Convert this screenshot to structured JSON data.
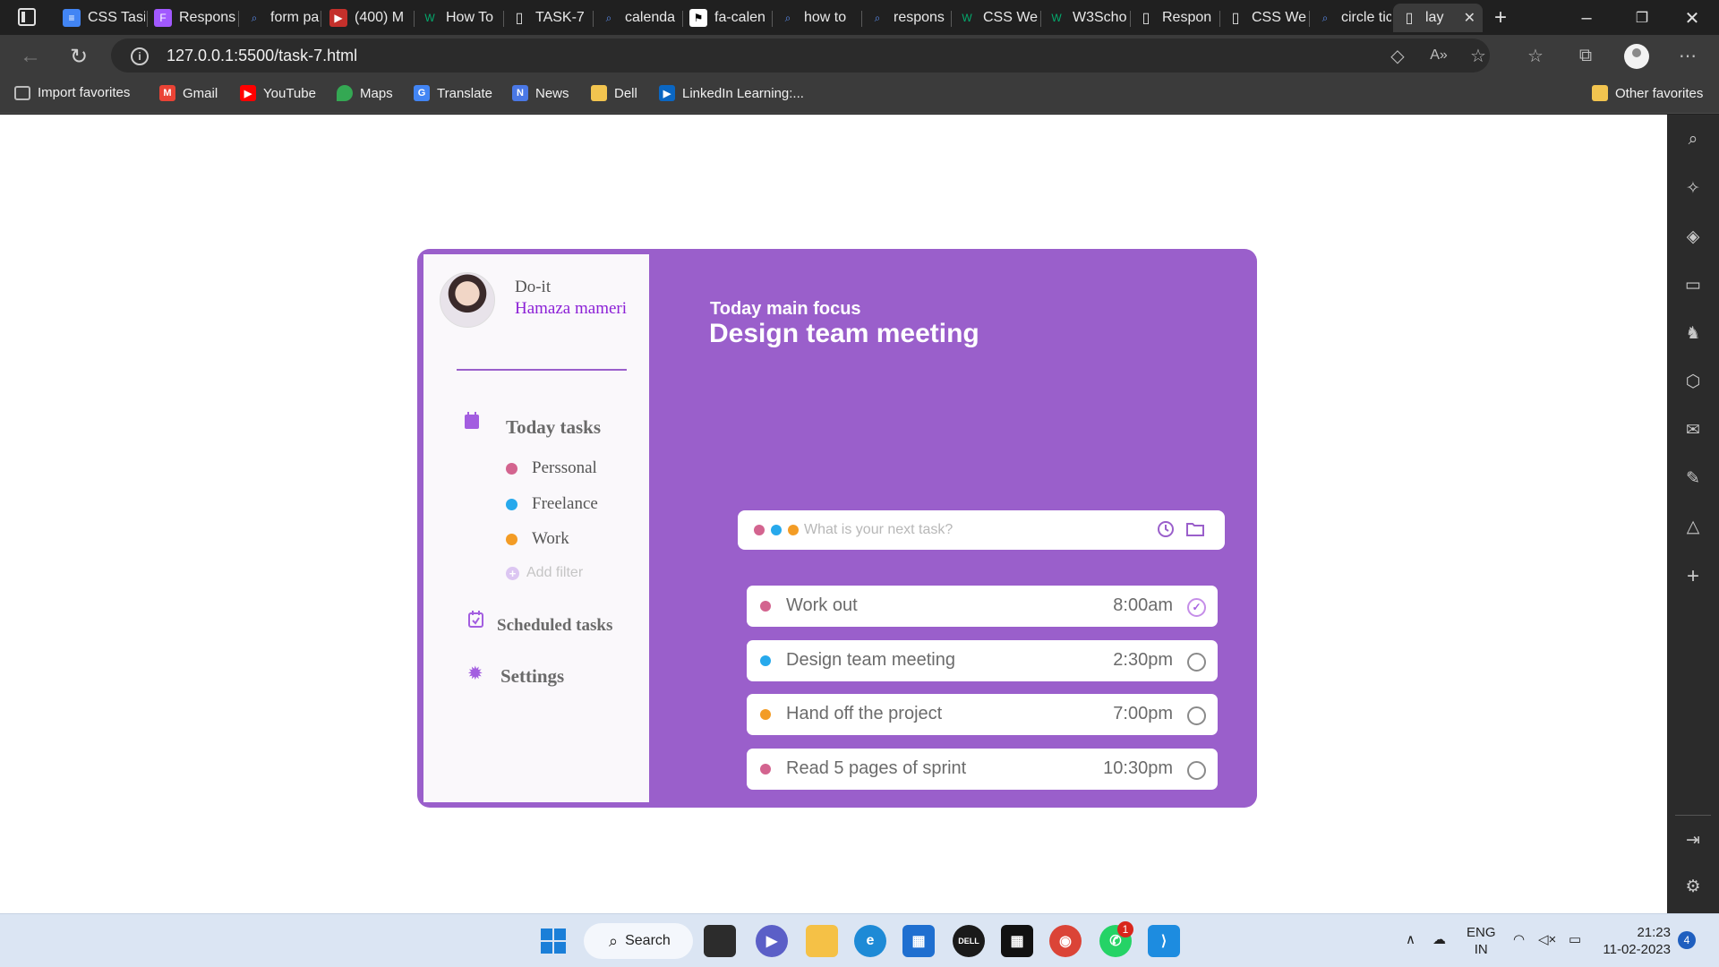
{
  "browser": {
    "tabs": [
      {
        "title": "CSS Tasi",
        "icon": "google-docs-icon",
        "color": "#4285f4"
      },
      {
        "title": "Respons",
        "icon": "figma-icon",
        "color": "#a259ff"
      },
      {
        "title": "form pa",
        "icon": "search-icon",
        "color": "#5b8def"
      },
      {
        "title": "(400) M",
        "icon": "youtube-icon",
        "color": "#ff0000"
      },
      {
        "title": "How To",
        "icon": "w3schools-icon",
        "color": "#04aa6d"
      },
      {
        "title": "TASK-7",
        "icon": "page-icon",
        "color": "#9e9e9e"
      },
      {
        "title": "calenda",
        "icon": "search-icon",
        "color": "#5b8def"
      },
      {
        "title": "fa-calen",
        "icon": "flag-icon",
        "color": "#ffffff"
      },
      {
        "title": "how to",
        "icon": "search-icon",
        "color": "#5b8def"
      },
      {
        "title": "respons",
        "icon": "search-icon",
        "color": "#5b8def"
      },
      {
        "title": "CSS We",
        "icon": "w3schools-icon",
        "color": "#04aa6d"
      },
      {
        "title": "W3Scho",
        "icon": "w3schools-icon",
        "color": "#04aa6d"
      },
      {
        "title": "Respon",
        "icon": "page-icon",
        "color": "#9e9e9e"
      },
      {
        "title": "CSS We",
        "icon": "page-icon",
        "color": "#9e9e9e"
      },
      {
        "title": "circle tic",
        "icon": "search-icon",
        "color": "#5b8def"
      },
      {
        "title": "lay",
        "icon": "page-icon",
        "color": "#9e9e9e",
        "active": true
      }
    ],
    "url": "127.0.0.1:5500/task-7.html",
    "favorites": [
      {
        "label": "Import favorites",
        "icon": "import-icon",
        "color": "#8a8a8a"
      },
      {
        "label": "Gmail",
        "icon": "gmail-icon",
        "color": "#ea4335"
      },
      {
        "label": "YouTube",
        "icon": "youtube-icon",
        "color": "#ff0000"
      },
      {
        "label": "Maps",
        "icon": "maps-icon",
        "color": "#34a853"
      },
      {
        "label": "Translate",
        "icon": "translate-icon",
        "color": "#4285f4"
      },
      {
        "label": "News",
        "icon": "news-icon",
        "color": "#4a78e6"
      },
      {
        "label": "Dell",
        "icon": "folder-icon",
        "color": "#f2c44f"
      },
      {
        "label": "LinkedIn Learning:...",
        "icon": "linkedin-learning-icon",
        "color": "#0a66c2"
      }
    ],
    "other_favorites": "Other favorites"
  },
  "app": {
    "name": "Do-it",
    "user": "Hamaza mameri",
    "nav": {
      "today": "Today tasks",
      "categories": [
        {
          "label": "Perssonal",
          "color": "#d3648f"
        },
        {
          "label": "Freelance",
          "color": "#27a9ec"
        },
        {
          "label": "Work",
          "color": "#f39c25"
        }
      ],
      "add_filter": "Add filter",
      "scheduled": "Scheduled tasks",
      "settings": "Settings"
    },
    "focus_label": "Today main focus",
    "focus_title": "Design team meeting",
    "input": {
      "placeholder": "What is your next task?",
      "dots": [
        "#d3648f",
        "#27a9ec",
        "#f39c25"
      ]
    },
    "tasks": [
      {
        "name": "Work out",
        "time": "8:00am",
        "color": "#d3648f",
        "done": true
      },
      {
        "name": "Design team meeting",
        "time": "2:30pm",
        "color": "#27a9ec",
        "done": false
      },
      {
        "name": "Hand off the project",
        "time": "7:00pm",
        "color": "#f39c25",
        "done": false
      },
      {
        "name": "Read 5 pages of sprint",
        "time": "10:30pm",
        "color": "#d3648f",
        "done": false
      }
    ],
    "accent": "#9a5fcb"
  },
  "taskbar": {
    "search_label": "Search",
    "language": "ENG",
    "region": "IN",
    "time": "21:23",
    "date": "11-02-2023",
    "notification_count": "4",
    "whatsapp_badge": "1"
  }
}
